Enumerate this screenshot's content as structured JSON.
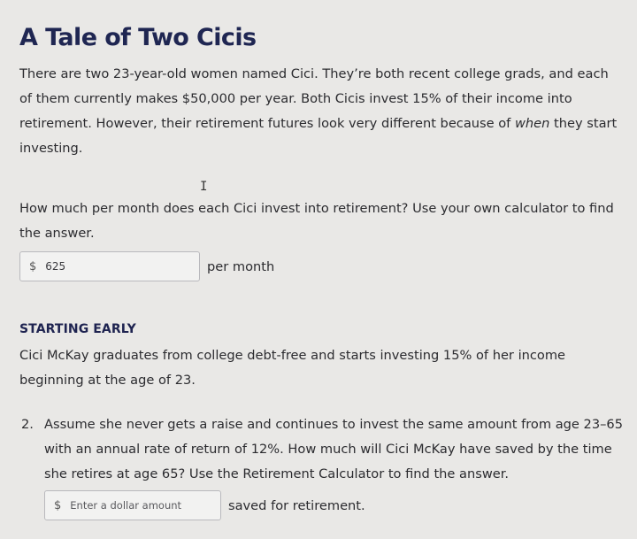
{
  "title": "A Tale of Two Cicis",
  "intro": {
    "part1": "There are two 23-year-old women named Cici. They’re both recent college grads, and each of them currently makes $50,000 per year. Both Cicis invest 15% of their income into retirement. However, their retirement futures look very different because of ",
    "emphasis": "when",
    "part2": " they start investing."
  },
  "question1": {
    "text": "How much per month does each Cici invest into retirement? Use your own calculator to find the answer.",
    "currency_symbol": "$",
    "value": "625",
    "suffix": "per month"
  },
  "starting_early": {
    "heading": "STARTING EARLY",
    "text": "Cici McKay graduates from college debt-free and starts investing 15% of her income beginning at the age of 23."
  },
  "question2": {
    "number": "2.",
    "text": "Assume she never gets a raise and continues to invest the same amount from age 23–65 with an annual rate of return of 12%. How much will Cici McKay have saved by the time she retires at age 65? Use the Retirement Calculator to find the answer.",
    "currency_symbol": "$",
    "placeholder": "Enter a dollar amount",
    "value": "",
    "suffix": "saved for retirement."
  },
  "cursor_glyph": "I"
}
